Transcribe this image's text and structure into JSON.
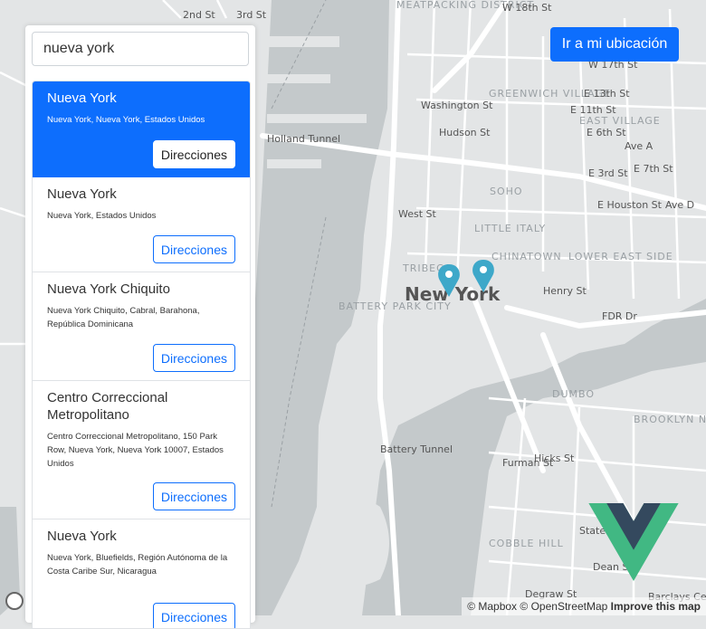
{
  "search": {
    "value": "nueva york",
    "placeholder": ""
  },
  "locate_button": {
    "label": "Ir a mi ubicación"
  },
  "results": [
    {
      "title": "Nueva York",
      "subtitle": "Nueva York, Nueva York, Estados Unidos",
      "button": "Direcciones",
      "active": true
    },
    {
      "title": "Nueva York",
      "subtitle": "Nueva York, Estados Unidos",
      "button": "Direcciones",
      "active": false
    },
    {
      "title": "Nueva York Chiquito",
      "subtitle": "Nueva York Chiquito, Cabral, Barahona, República Dominicana",
      "button": "Direcciones",
      "active": false
    },
    {
      "title": "Centro Correccional Metropolitano",
      "subtitle": "Centro Correccional Metropolitano, 150 Park Row, Nueva York, Nueva York 10007, Estados Unidos",
      "button": "Direcciones",
      "active": false
    },
    {
      "title": "Nueva York",
      "subtitle": "Nueva York, Bluefields, Región Autónoma de la Costa Caribe Sur, Nicaragua",
      "button": "Direcciones",
      "active": false
    }
  ],
  "map": {
    "city_label": "New York",
    "neighborhoods": [
      "MEATPACKING DISTRICT",
      "GREENWICH VILLAGE",
      "EAST VILLAGE",
      "SOHO",
      "LITTLE ITALY",
      "CHINATOWN",
      "LOWER EAST SIDE",
      "TRIBECA",
      "BATTERY PARK CITY",
      "DUMBO",
      "BROOKLYN NAVY YARD",
      "COBBLE HILL"
    ],
    "streets": [
      "W 18th St",
      "W 17th St",
      "E 13th St",
      "E 11th St",
      "E 6th St",
      "E 7th St",
      "E 3rd St",
      "E Houston St",
      "Ave A",
      "Ave D",
      "Henry St",
      "FDR Dr",
      "Holland Tunnel",
      "West St",
      "Hudson St",
      "Washington St",
      "Battery Tunnel",
      "Furman St",
      "Hicks St",
      "State St",
      "Dean St",
      "Degraw St",
      "2nd St",
      "3rd St",
      "Barclays Cen"
    ],
    "pins": 2
  },
  "attribution": {
    "mapbox": "© Mapbox",
    "osm": "© OpenStreetMap",
    "improve": "Improve this map"
  },
  "colors": {
    "accent": "#0d6efd",
    "water": "#c4c9cb",
    "land": "#e3e5e6",
    "road": "#ffffff",
    "pin": "#3ea8c9",
    "vue_green": "#41b883",
    "vue_dark": "#34495e"
  }
}
